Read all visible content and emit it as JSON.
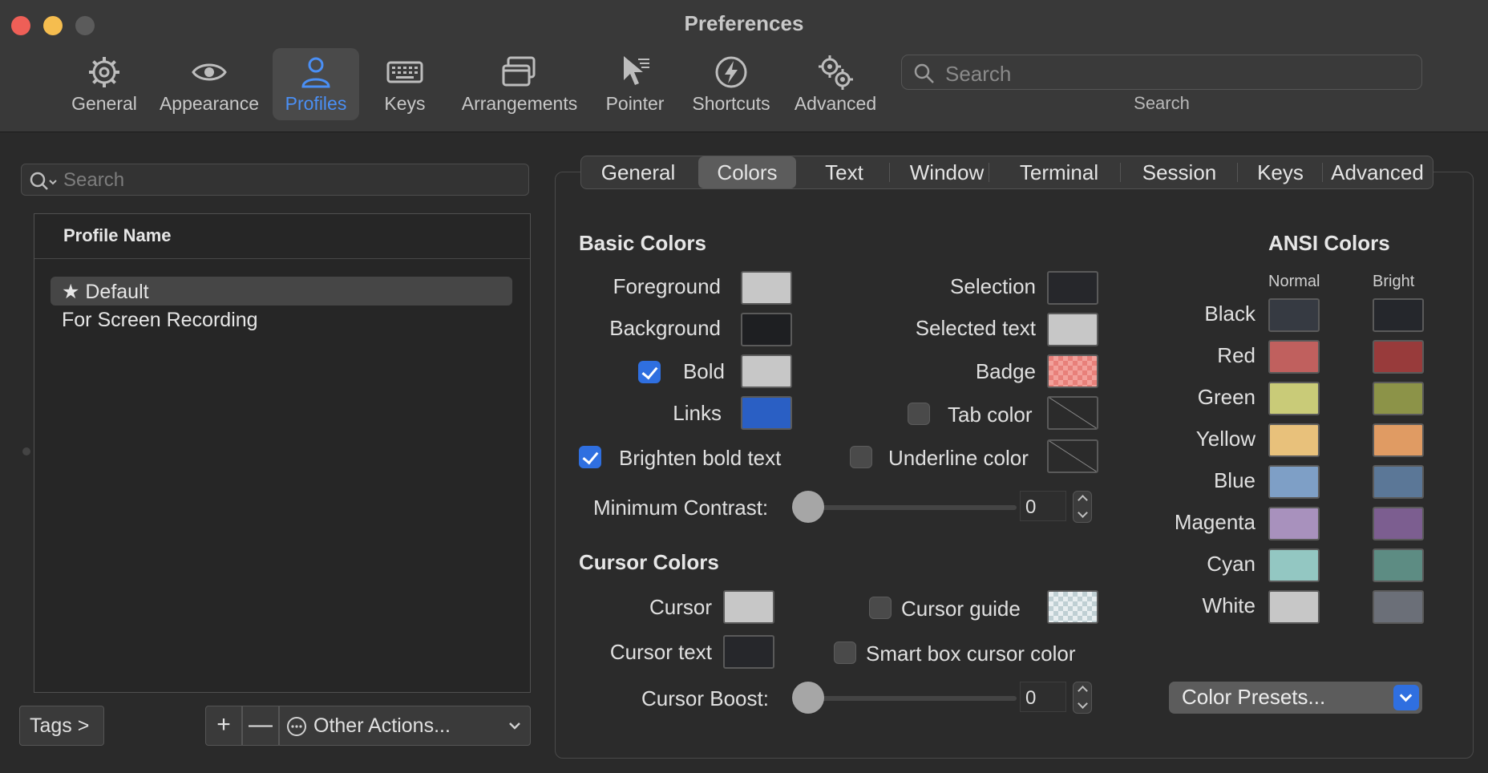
{
  "window": {
    "title": "Preferences"
  },
  "toolbar": {
    "items": [
      {
        "label": "General",
        "icon": "gear-icon"
      },
      {
        "label": "Appearance",
        "icon": "eye-icon"
      },
      {
        "label": "Profiles",
        "icon": "person-icon",
        "active": true
      },
      {
        "label": "Keys",
        "icon": "keyboard-icon"
      },
      {
        "label": "Arrangements",
        "icon": "windows-icon"
      },
      {
        "label": "Pointer",
        "icon": "cursor-icon"
      },
      {
        "label": "Shortcuts",
        "icon": "bolt-icon"
      },
      {
        "label": "Advanced",
        "icon": "gears-icon"
      }
    ],
    "search_placeholder": "Search",
    "search_label": "Search"
  },
  "profiles": {
    "search_placeholder": "Search",
    "column_header": "Profile Name",
    "items": [
      {
        "name": "Default",
        "default_marker": "★",
        "selected": true
      },
      {
        "name": "For Screen Recording",
        "selected": false
      }
    ],
    "tags_label": "Tags >",
    "add_label": "+",
    "remove_label": "—",
    "other_actions_label": "Other Actions..."
  },
  "tabs": [
    {
      "label": "General"
    },
    {
      "label": "Colors",
      "active": true
    },
    {
      "label": "Text"
    },
    {
      "label": "Window"
    },
    {
      "label": "Terminal"
    },
    {
      "label": "Session"
    },
    {
      "label": "Keys"
    },
    {
      "label": "Advanced"
    }
  ],
  "basic_colors": {
    "title": "Basic Colors",
    "foreground": {
      "label": "Foreground",
      "color": "#c7c7c7"
    },
    "background": {
      "label": "Background",
      "color": "#1e1f22"
    },
    "bold": {
      "label": "Bold",
      "color": "#c7c7c7",
      "checked": true
    },
    "links": {
      "label": "Links",
      "color": "#2a5fc4"
    },
    "brighten_bold": {
      "label": "Brighten bold text",
      "checked": true
    },
    "selection": {
      "label": "Selection",
      "color": "#26272b"
    },
    "selected_text": {
      "label": "Selected text",
      "color": "#c7c7c7"
    },
    "badge": {
      "label": "Badge",
      "color": "#e8807a"
    },
    "tab_color": {
      "label": "Tab color",
      "checked": false
    },
    "underline_color": {
      "label": "Underline color",
      "checked": false
    },
    "min_contrast": {
      "label": "Minimum Contrast:",
      "value": "0"
    }
  },
  "cursor_colors": {
    "title": "Cursor Colors",
    "cursor": {
      "label": "Cursor",
      "color": "#c7c7c7"
    },
    "cursor_text": {
      "label": "Cursor text",
      "color": "#26272b"
    },
    "cursor_guide": {
      "label": "Cursor guide",
      "checked": false
    },
    "smart_box": {
      "label": "Smart box cursor color",
      "checked": false
    },
    "cursor_boost": {
      "label": "Cursor Boost:",
      "value": "0"
    }
  },
  "ansi": {
    "title": "ANSI Colors",
    "normal_label": "Normal",
    "bright_label": "Bright",
    "rows": [
      {
        "name": "Black",
        "normal": "#363a42",
        "bright": "#25272c"
      },
      {
        "name": "Red",
        "normal": "#c0605e",
        "bright": "#983b3b"
      },
      {
        "name": "Green",
        "normal": "#c9cb78",
        "bright": "#8c9348"
      },
      {
        "name": "Yellow",
        "normal": "#e8c17b",
        "bright": "#e09b63"
      },
      {
        "name": "Blue",
        "normal": "#7e9fc6",
        "bright": "#5b7797"
      },
      {
        "name": "Magenta",
        "normal": "#a891bd",
        "bright": "#7c5e90"
      },
      {
        "name": "Cyan",
        "normal": "#93c7c2",
        "bright": "#5d8c83"
      },
      {
        "name": "White",
        "normal": "#c7c7c7",
        "bright": "#6b6f78"
      }
    ],
    "presets_label": "Color Presets..."
  }
}
